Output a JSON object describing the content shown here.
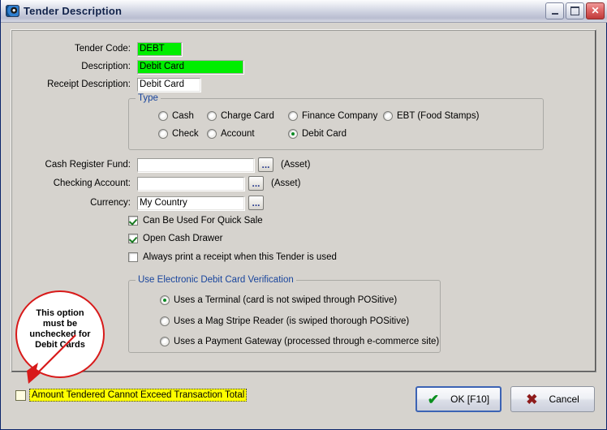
{
  "window": {
    "title": "Tender Description",
    "icon": "app-eye-icon",
    "buttons": {
      "minimize": "–",
      "maximize": "❐",
      "close": "✕"
    }
  },
  "form": {
    "tender_code": {
      "label": "Tender Code:",
      "value": "DEBT"
    },
    "description": {
      "label": "Description:",
      "value": "Debit Card"
    },
    "receipt_description": {
      "label": "Receipt Description:",
      "value": "Debit Card"
    },
    "cash_register_fund": {
      "label": "Cash Register Fund:",
      "value": "",
      "suffix": "(Asset)",
      "browse": "..."
    },
    "checking_account": {
      "label": "Checking Account:",
      "value": "",
      "suffix": "(Asset)",
      "browse": "..."
    },
    "currency": {
      "label": "Currency:",
      "value": "My Country",
      "browse": "..."
    }
  },
  "type_group": {
    "title": "Type",
    "options": [
      {
        "label": "Cash",
        "selected": false
      },
      {
        "label": "Charge Card",
        "selected": false
      },
      {
        "label": "Finance Company",
        "selected": false
      },
      {
        "label": "EBT (Food Stamps)",
        "selected": false
      },
      {
        "label": "Check",
        "selected": false
      },
      {
        "label": "Account",
        "selected": false
      },
      {
        "label": "Debit Card",
        "selected": true
      }
    ]
  },
  "checkboxes": [
    {
      "label": "Can Be Used For Quick Sale",
      "checked": true
    },
    {
      "label": "Open Cash Drawer",
      "checked": true
    },
    {
      "label": "Always print a receipt when this Tender is used",
      "checked": false
    }
  ],
  "verification_group": {
    "title": "Use Electronic Debit Card Verification",
    "options": [
      {
        "label": "Uses a Terminal (card is not swiped through POSitive)",
        "selected": true
      },
      {
        "label": "Uses a Mag Stripe Reader (is swiped thorough POSitive)",
        "selected": false
      },
      {
        "label": "Uses a Payment Gateway (processed through e-commerce site)",
        "selected": false
      }
    ]
  },
  "bottom_option": {
    "label": "Amount Tendered Cannot Exceed Transaction Total",
    "checked": false,
    "highlight_color": "#ffff00"
  },
  "annotation": {
    "line1": "This option",
    "line2": "must be",
    "line3": "unchecked for",
    "line4": "Debit Cards",
    "color": "#d81a1a"
  },
  "actions": {
    "ok": "OK [F10]",
    "cancel": "Cancel"
  }
}
